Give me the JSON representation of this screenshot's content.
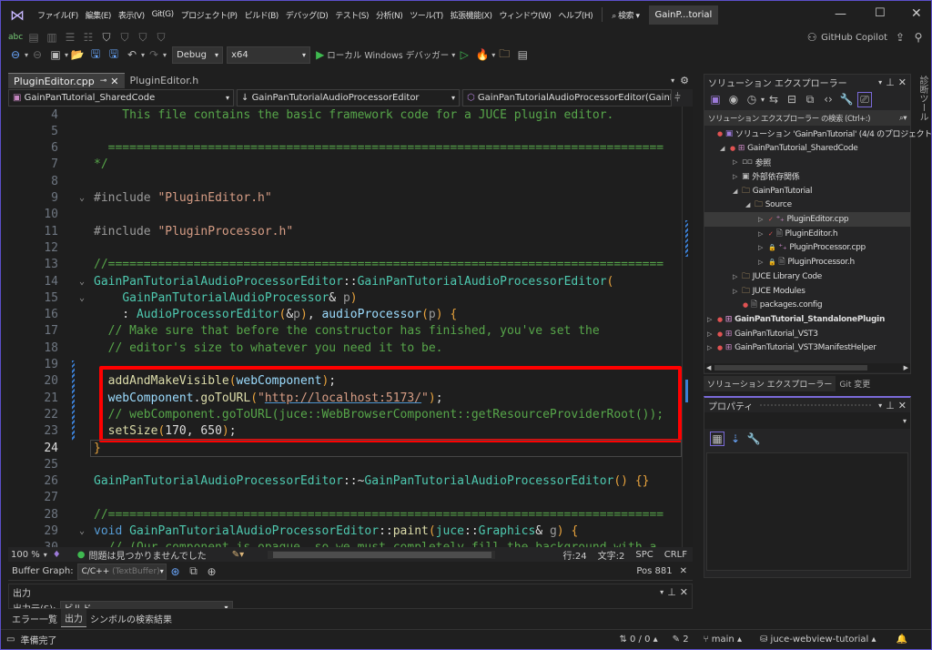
{
  "title_bar": {
    "menus": [
      "ファイル(F)",
      "編集(E)",
      "表示(V)",
      "Git(G)",
      "プロジェクト(P)",
      "ビルド(B)",
      "デバッグ(D)",
      "テスト(S)",
      "分析(N)",
      "ツール(T)",
      "拡張機能(X)",
      "ウィンドウ(W)",
      "ヘルプ(H)"
    ],
    "search": "検索",
    "solution_badge": "GainP...torial"
  },
  "toolbar": {
    "copilot": "GitHub Copilot",
    "config": "Debug",
    "platform": "x64",
    "run_label": "ローカル Windows デバッガー"
  },
  "tabs": [
    {
      "label": "PluginEditor.cpp",
      "active": true
    },
    {
      "label": "PluginEditor.h",
      "active": false
    }
  ],
  "navbar": {
    "project": "GainPanTutorial_SharedCode",
    "class": "GainPanTutorialAudioProcessorEditor",
    "member": "GainPanTutorialAudioProcessorEditor(GainPanTut"
  },
  "code": [
    {
      "n": "4",
      "t": [
        [
          "comment",
          "    This file contains the basic framework code for a JUCE plugin editor."
        ]
      ]
    },
    {
      "n": "5",
      "t": []
    },
    {
      "n": "6",
      "t": [
        [
          "comment",
          "  =============================================================================="
        ]
      ]
    },
    {
      "n": "7",
      "t": [
        [
          "comment",
          "*/"
        ]
      ]
    },
    {
      "n": "8",
      "t": []
    },
    {
      "n": "9",
      "t": [
        [
          "pp",
          "#include "
        ],
        [
          "string",
          "\"PluginEditor.h\""
        ]
      ]
    },
    {
      "n": "10",
      "t": []
    },
    {
      "n": "11",
      "t": [
        [
          "pp",
          "#include "
        ],
        [
          "string",
          "\"PluginProcessor.h\""
        ]
      ]
    },
    {
      "n": "12",
      "t": []
    },
    {
      "n": "13",
      "t": [
        [
          "comment",
          "//=============================================================================="
        ]
      ]
    },
    {
      "n": "14",
      "t": [
        [
          "type",
          "GainPanTutorialAudioProcessorEditor"
        ],
        [
          "plain",
          "::"
        ],
        [
          "type",
          "GainPanTutorialAudioProcessorEditor"
        ],
        [
          "paren",
          "("
        ]
      ]
    },
    {
      "n": "15",
      "t": [
        [
          "plain",
          "    "
        ],
        [
          "type",
          "GainPanTutorialAudioProcessor"
        ],
        [
          "plain",
          "& "
        ],
        [
          "param",
          "p"
        ],
        [
          "paren",
          ")"
        ]
      ]
    },
    {
      "n": "16",
      "t": [
        [
          "plain",
          "    : "
        ],
        [
          "type",
          "AudioProcessorEditor"
        ],
        [
          "paren",
          "("
        ],
        [
          "plain",
          "&"
        ],
        [
          "param",
          "p"
        ],
        [
          "paren",
          ")"
        ],
        [
          "plain",
          ", "
        ],
        [
          "var",
          "audioProcessor"
        ],
        [
          "paren",
          "("
        ],
        [
          "param",
          "p"
        ],
        [
          "paren",
          ")"
        ],
        [
          "plain",
          " "
        ],
        [
          "paren",
          "{"
        ]
      ]
    },
    {
      "n": "17",
      "t": [
        [
          "comment",
          "  // Make sure that before the constructor has finished, you've set the"
        ]
      ]
    },
    {
      "n": "18",
      "t": [
        [
          "comment",
          "  // editor's size to whatever you need it to be."
        ]
      ]
    },
    {
      "n": "19",
      "t": []
    },
    {
      "n": "20",
      "t": [
        [
          "plain",
          "  "
        ],
        [
          "func",
          "addAndMakeVisible"
        ],
        [
          "paren",
          "("
        ],
        [
          "var",
          "webComponent"
        ],
        [
          "paren",
          ")"
        ],
        [
          "plain",
          ";"
        ]
      ]
    },
    {
      "n": "21",
      "t": [
        [
          "plain",
          "  "
        ],
        [
          "var",
          "webComponent"
        ],
        [
          "plain",
          "."
        ],
        [
          "func",
          "goToURL"
        ],
        [
          "paren",
          "("
        ],
        [
          "string",
          "\""
        ],
        [
          "link",
          "http://localhost:5173/"
        ],
        [
          "string",
          "\""
        ],
        [
          "paren",
          ")"
        ],
        [
          "plain",
          ";"
        ]
      ]
    },
    {
      "n": "22",
      "t": [
        [
          "comment",
          "  // webComponent.goToURL(juce::WebBrowserComponent::getResourceProviderRoot());"
        ]
      ]
    },
    {
      "n": "23",
      "t": [
        [
          "plain",
          "  "
        ],
        [
          "func",
          "setSize"
        ],
        [
          "paren",
          "("
        ],
        [
          "plain",
          "170, 650"
        ],
        [
          "paren",
          ")"
        ],
        [
          "plain",
          ";"
        ]
      ]
    },
    {
      "n": "24",
      "t": [
        [
          "paren",
          "}"
        ]
      ]
    },
    {
      "n": "25",
      "t": []
    },
    {
      "n": "26",
      "t": [
        [
          "type",
          "GainPanTutorialAudioProcessorEditor"
        ],
        [
          "plain",
          "::~"
        ],
        [
          "type",
          "GainPanTutorialAudioProcessorEditor"
        ],
        [
          "paren",
          "()"
        ],
        [
          "plain",
          " "
        ],
        [
          "paren",
          "{}"
        ]
      ]
    },
    {
      "n": "27",
      "t": []
    },
    {
      "n": "28",
      "t": [
        [
          "comment",
          "//=============================================================================="
        ]
      ]
    },
    {
      "n": "29",
      "t": [
        [
          "kw",
          "void "
        ],
        [
          "type",
          "GainPanTutorialAudioProcessorEditor"
        ],
        [
          "plain",
          "::"
        ],
        [
          "func",
          "paint"
        ],
        [
          "paren",
          "("
        ],
        [
          "type",
          "juce"
        ],
        [
          "plain",
          "::"
        ],
        [
          "type",
          "Graphics"
        ],
        [
          "plain",
          "& "
        ],
        [
          "param",
          "g"
        ],
        [
          "paren",
          ")"
        ],
        [
          "plain",
          " "
        ],
        [
          "paren",
          "{"
        ]
      ]
    },
    {
      "n": "30",
      "t": [
        [
          "comment",
          "  // (Our component is opaque, so we must completely fill the background with a"
        ]
      ]
    }
  ],
  "editor_status": {
    "zoom": "100 %",
    "issues": "問題は見つかりませんでした",
    "line": "行:24",
    "col": "文字:2",
    "spc": "SPC",
    "crlf": "CRLF"
  },
  "buffer_graph": {
    "label": "Buffer Graph:",
    "value": "C/C++",
    "value_hint": "(TextBuffer)",
    "pos": "Pos 881"
  },
  "output": {
    "title": "出力",
    "source_label": "出力元(S):",
    "source": "ビルド",
    "tabs": [
      "エラー一覧",
      "出力",
      "シンボルの検索結果"
    ]
  },
  "solution_explorer": {
    "title": "ソリューション エクスプローラー",
    "search_placeholder": "ソリューション エクスプローラー の検索 (Ctrl+:)",
    "items": [
      {
        "label": "ソリューション 'GainPanTutorial' (4/4 のプロジェクト",
        "depth": 0,
        "exp": "",
        "icon": "solution",
        "bold": false
      },
      {
        "label": "GainPanTutorial_SharedCode",
        "depth": 1,
        "exp": "◢",
        "icon": "project",
        "bold": false
      },
      {
        "label": "参照",
        "depth": 2,
        "exp": "▷",
        "icon": "ref",
        "bold": false
      },
      {
        "label": "外部依存関係",
        "depth": 2,
        "exp": "▷",
        "icon": "ext",
        "bold": false
      },
      {
        "label": "GainPanTutorial",
        "depth": 2,
        "exp": "◢",
        "icon": "filter",
        "bold": false
      },
      {
        "label": "Source",
        "depth": 3,
        "exp": "◢",
        "icon": "filter",
        "bold": false
      },
      {
        "label": "PluginEditor.cpp",
        "depth": 4,
        "exp": "▷",
        "icon": "cpp",
        "bold": false,
        "selected": true,
        "mark": "✓"
      },
      {
        "label": "PluginEditor.h",
        "depth": 4,
        "exp": "▷",
        "icon": "h",
        "bold": false,
        "mark": "✓"
      },
      {
        "label": "PluginProcessor.cpp",
        "depth": 4,
        "exp": "▷",
        "icon": "cpp",
        "bold": false,
        "mark": "🔒"
      },
      {
        "label": "PluginProcessor.h",
        "depth": 4,
        "exp": "▷",
        "icon": "h",
        "bold": false,
        "mark": "🔒"
      },
      {
        "label": "JUCE Library Code",
        "depth": 2,
        "exp": "▷",
        "icon": "filter",
        "bold": false
      },
      {
        "label": "JUCE Modules",
        "depth": 2,
        "exp": "▷",
        "icon": "filter",
        "bold": false
      },
      {
        "label": "packages.config",
        "depth": 2,
        "exp": "",
        "icon": "file",
        "bold": false
      },
      {
        "label": "GainPanTutorial_StandalonePlugin",
        "depth": 0,
        "exp": "▷",
        "icon": "project",
        "bold": true
      },
      {
        "label": "GainPanTutorial_VST3",
        "depth": 0,
        "exp": "▷",
        "icon": "project",
        "bold": false
      },
      {
        "label": "GainPanTutorial_VST3ManifestHelper",
        "depth": 0,
        "exp": "▷",
        "icon": "project",
        "bold": false
      }
    ],
    "bottom_tabs": [
      "ソリューション エクスプローラー",
      "Git 変更"
    ]
  },
  "properties": {
    "title": "プロパティ"
  },
  "side_strip": {
    "label": "診断ツール"
  },
  "status_bar": {
    "ready": "準備完了",
    "errors": "0 / 0",
    "edits": "2",
    "branch": "main",
    "repo": "juce-webview-tutorial"
  },
  "colors": {
    "accent": "#5b4fc9",
    "highlight_box": "#ff0000",
    "run": "#3fb950"
  }
}
